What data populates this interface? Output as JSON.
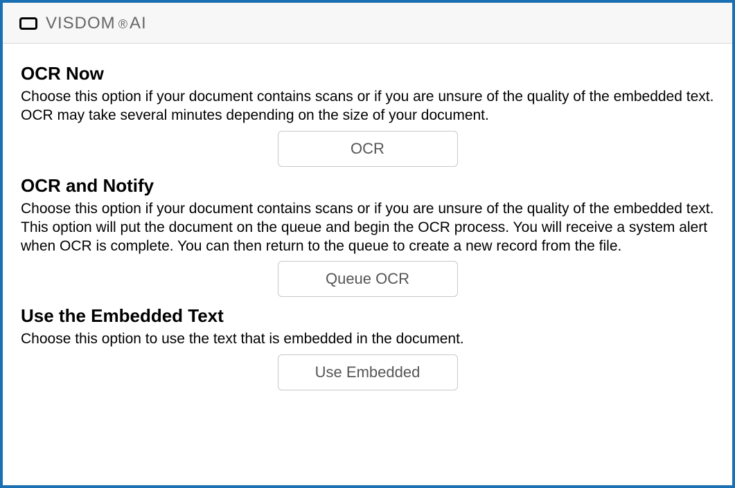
{
  "window": {
    "brand": "VISDOM",
    "registered": "®",
    "suffix": " AI"
  },
  "sections": {
    "ocr_now": {
      "title": "OCR Now",
      "desc": "Choose this option if your document contains scans or if you are unsure of the quality of the embedded text. OCR may take several minutes depending on the size of your document.",
      "button": "OCR"
    },
    "ocr_notify": {
      "title": "OCR and Notify",
      "desc": "Choose this option if your document contains scans or if you are unsure of the quality of the embedded text. This option will put the document on the queue and begin the OCR process. You will receive a system alert when OCR is complete. You can then return to the queue to create a new record from the file.",
      "button": "Queue OCR"
    },
    "use_embedded": {
      "title": "Use the Embedded Text",
      "desc": "Choose this option to use the text that is embedded in the document.",
      "button": "Use Embedded"
    }
  }
}
